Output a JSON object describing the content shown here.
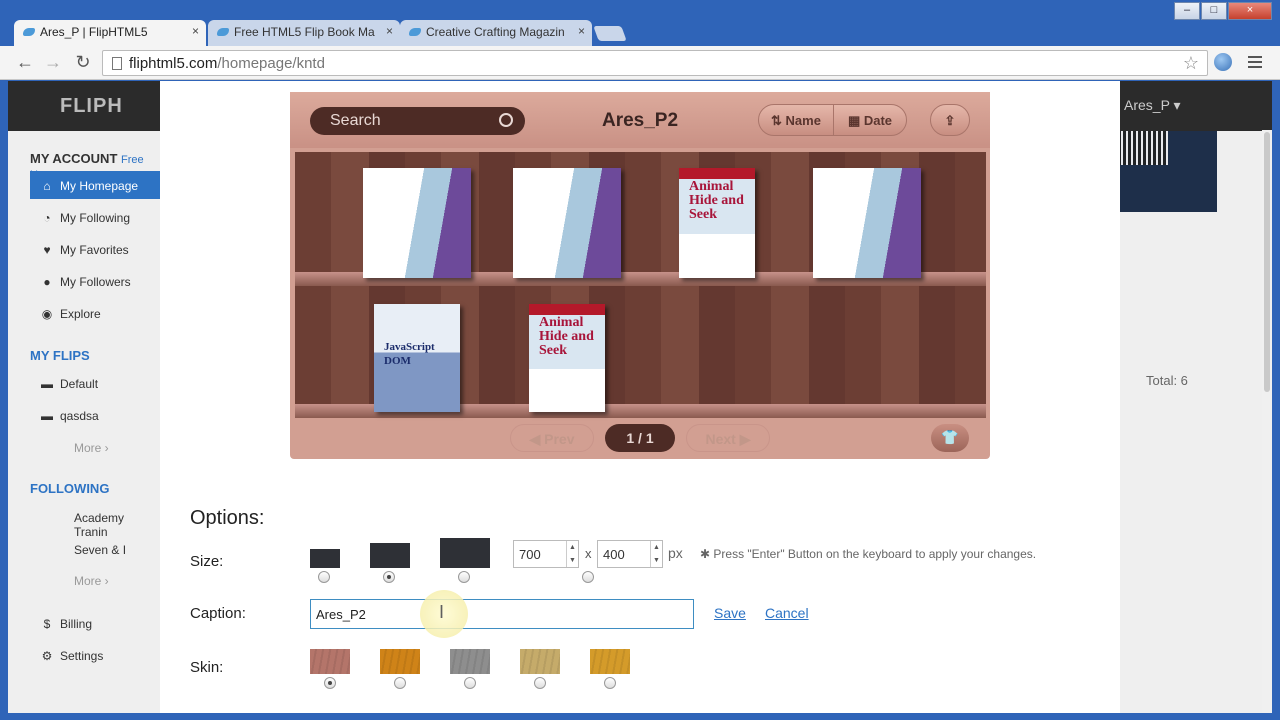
{
  "browser": {
    "tabs": [
      {
        "title": "Ares_P | FlipHTML5"
      },
      {
        "title": "Free HTML5 Flip Book Ma"
      },
      {
        "title": "Creative Crafting Magazin"
      }
    ],
    "close_glyph": "×",
    "url_domain": "fliphtml5.com",
    "url_path": "/homepage/kntd",
    "window_controls": {
      "minimize": "–",
      "maximize": "□",
      "close": "×"
    }
  },
  "site": {
    "logo": "FLIPH",
    "user": "Ares_P ▾",
    "total": "Total: 6",
    "sidebar": {
      "account_heading": "MY ACCOUNT",
      "account_sub": "Free Us",
      "items": [
        {
          "label": "My Homepage",
          "icon": "home-icon"
        },
        {
          "label": "My Following",
          "icon": "rss-icon"
        },
        {
          "label": "My Favorites",
          "icon": "heart-icon"
        },
        {
          "label": "My Followers",
          "icon": "users-icon"
        },
        {
          "label": "Explore",
          "icon": "eye-icon"
        }
      ],
      "flips_heading": "MY FLIPS",
      "flips": [
        {
          "label": "Default"
        },
        {
          "label": "qasdsa"
        }
      ],
      "more": "More ›",
      "following_heading": "FOLLOWING",
      "following": [
        {
          "label": "Academy Tranin"
        },
        {
          "label": "Seven & I"
        }
      ],
      "billing": "Billing",
      "settings": "Settings"
    }
  },
  "bookshelf": {
    "search_placeholder": "Search",
    "title": "Ares_P2",
    "sort_name": "Name",
    "sort_date": "Date",
    "prev": "◀ Prev",
    "page": "1 / 1",
    "next": "Next ▶",
    "book_titles": [
      "Animal Hide and Seek",
      "JavaScript DOM"
    ]
  },
  "options": {
    "heading": "Options:",
    "size_label": "Size:",
    "width": "700",
    "height": "400",
    "x_sep": "x",
    "unit": "px",
    "hint": "✱ Press \"Enter\" Button on the keyboard to apply your changes.",
    "caption_label": "Caption:",
    "caption_value": "Ares_P2",
    "save": "Save",
    "cancel": "Cancel",
    "skin_label": "Skin:",
    "size_selected_index": 1,
    "skin_selected_index": 0,
    "skin_colors": [
      "#b4756a",
      "#cf8318",
      "#8e8e8e",
      "#c5ab6a",
      "#d49b2a"
    ]
  }
}
